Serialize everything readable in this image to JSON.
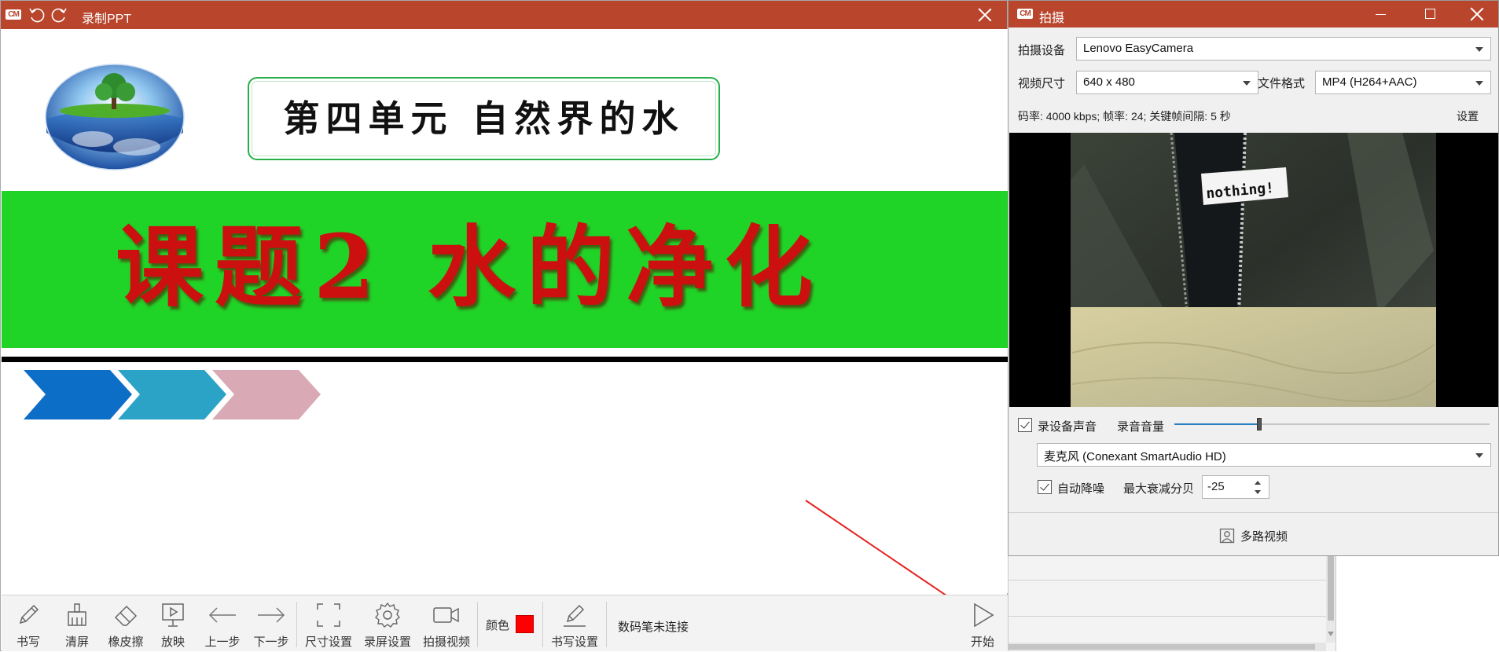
{
  "ppt_window": {
    "title": "录制PPT",
    "logo_text": "CM"
  },
  "slide": {
    "unit_title": "第四单元  自然界的水",
    "lesson_title": "课题2  水的净化",
    "chevron_colors": [
      "#0d6ec7",
      "#2aa3c7",
      "#d9aab5"
    ]
  },
  "toolbar": {
    "write": "书写",
    "clear": "清屏",
    "eraser": "橡皮擦",
    "play": "放映",
    "prev": "上一步",
    "next": "下一步",
    "size": "尺寸设置",
    "record_settings": "录屏设置",
    "capture_video": "拍摄视频",
    "color_label": "颜色",
    "color_value": "#ff0000",
    "write_settings": "书写设置",
    "pen_status": "数码笔未连接",
    "start": "开始"
  },
  "camera_window": {
    "title": "拍摄",
    "logo_text": "CM",
    "device_label": "拍摄设备",
    "device_value": "Lenovo EasyCamera",
    "size_label": "视频尺寸",
    "size_value": "640 x 480",
    "format_label": "文件格式",
    "format_value": "MP4 (H264+AAC)",
    "info": "码率: 4000 kbps; 帧率: 24; 关键帧间隔: 5 秒",
    "settings_link": "设置",
    "preview_text": "nothing!",
    "record_audio_label": "录设备声音",
    "record_audio_checked": true,
    "volume_label": "录音音量",
    "volume_level": 0.27,
    "mic_value": "麦克风 (Conexant SmartAudio HD)",
    "denoise_label": "自动降噪",
    "denoise_checked": true,
    "max_atten_label": "最大衰减分贝",
    "max_atten_value": "-25",
    "multi_video": "多路视频"
  },
  "colors": {
    "title_bar": "#b8452c",
    "slide_green": "#20d327",
    "lesson_red": "#cc1010",
    "annotation_arrow": "#e52420"
  }
}
